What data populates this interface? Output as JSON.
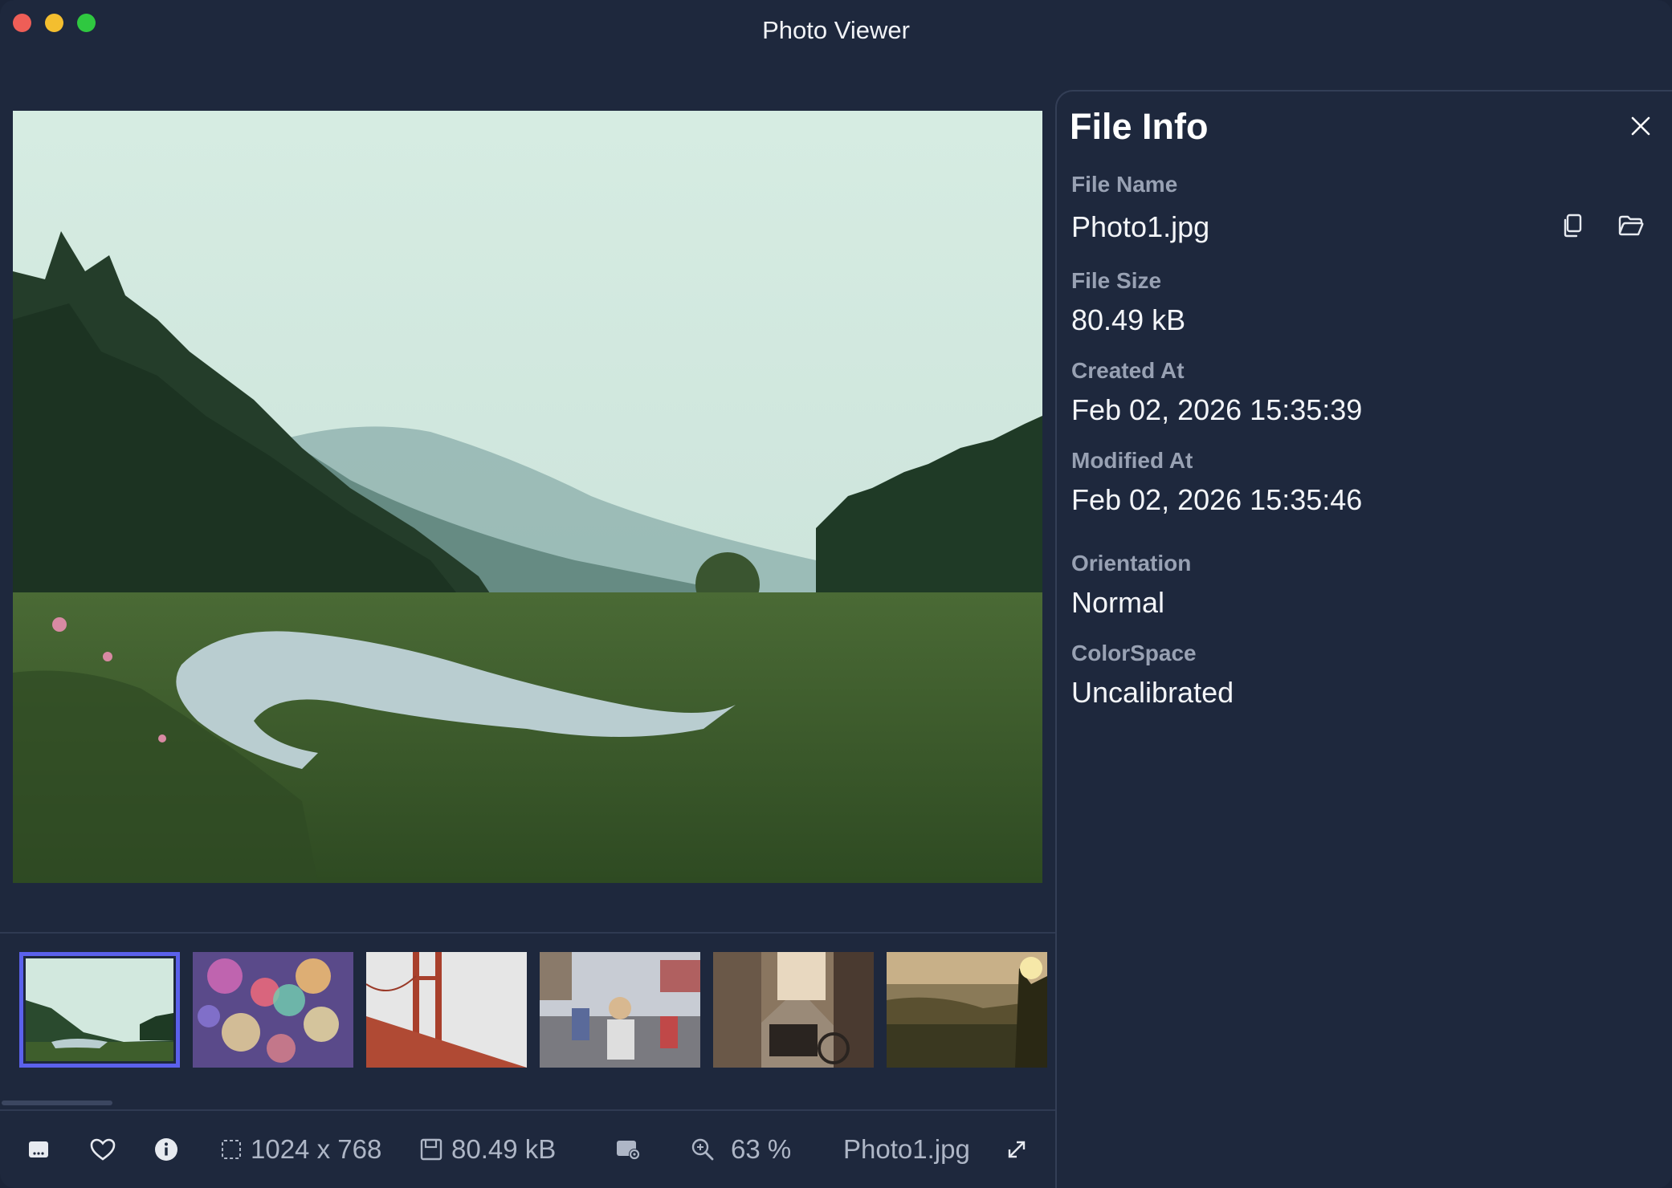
{
  "window": {
    "title": "Photo Viewer"
  },
  "panel": {
    "title": "File Info",
    "fields": [
      {
        "label": "File Name",
        "value": "Photo1.jpg"
      },
      {
        "label": "File Size",
        "value": "80.49 kB"
      },
      {
        "label": "Created At",
        "value": "Feb 02, 2026 15:35:39"
      },
      {
        "label": "Modified At",
        "value": "Feb 02, 2026 15:35:46"
      },
      {
        "label": "Orientation",
        "value": "Normal"
      },
      {
        "label": "ColorSpace",
        "value": "Uncalibrated"
      }
    ]
  },
  "thumbnails": [
    {
      "subject": "misty river valley",
      "selected": true
    },
    {
      "subject": "colorful bokeh lights",
      "selected": false
    },
    {
      "subject": "golden gate bridge in fog",
      "selected": false
    },
    {
      "subject": "busy street with scooters",
      "selected": false
    },
    {
      "subject": "old street with bicycle",
      "selected": false
    },
    {
      "subject": "sunset over forest hills",
      "selected": false
    }
  ],
  "statusbar": {
    "dimensions": "1024 x 768",
    "size": "80.49 kB",
    "zoom": "63 %",
    "filename": "Photo1.jpg"
  },
  "icons": {
    "toolbar": [
      "slideshow-icon",
      "heart-icon",
      "info-icon",
      "crop-icon",
      "save-icon",
      "image-settings-icon",
      "zoom-icon",
      "fullscreen-icon"
    ],
    "panel": [
      "close-icon",
      "copy-icon",
      "folder-icon"
    ]
  },
  "colors": {
    "background": "#1e283d",
    "accent": "#5b61ec",
    "label": "#98a1b3",
    "text": "#f3f5f8"
  }
}
